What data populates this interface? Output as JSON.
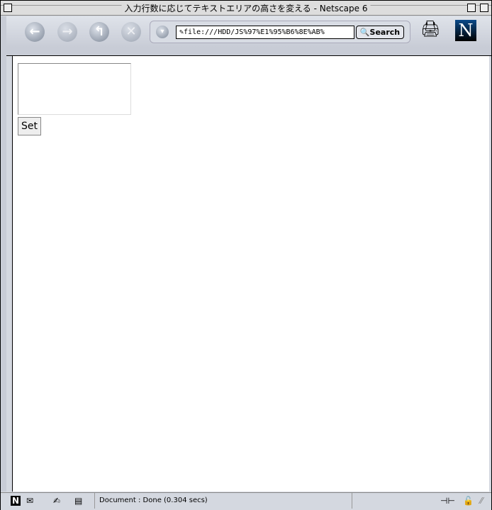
{
  "window": {
    "title": "入力行数に応じてテキストエリアの高さを変える - Netscape 6"
  },
  "toolbar": {
    "url": "file:///HDD/JS%97%E1%95%B6%8E%AB%",
    "search_label": "Search",
    "logo": "N"
  },
  "page": {
    "textarea_value": "",
    "set_label": "Set"
  },
  "status": {
    "message": "Document : Done (0.304 secs)"
  }
}
